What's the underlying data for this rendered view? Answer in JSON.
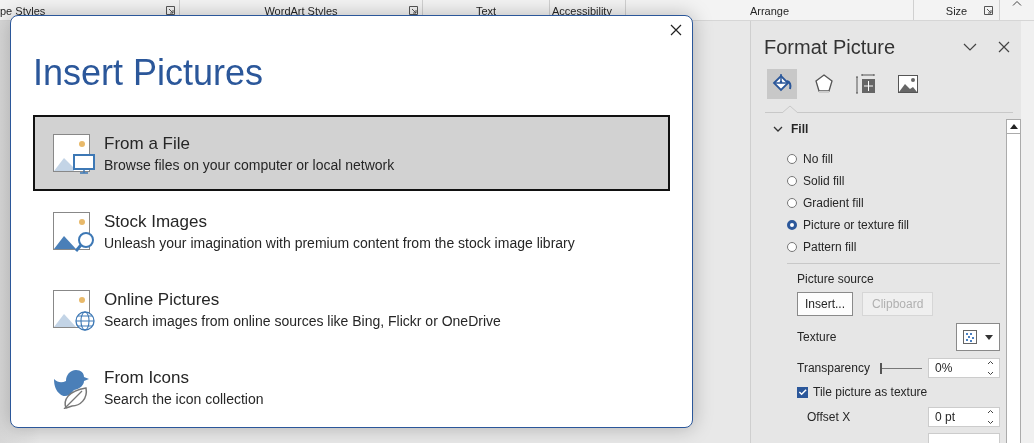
{
  "ribbon": {
    "groups": [
      {
        "label": "pe Styles",
        "launcher": true
      },
      {
        "label": "WordArt Styles",
        "launcher": true
      },
      {
        "label": "Text",
        "launcher": false
      },
      {
        "label": "Accessibility",
        "launcher": false
      },
      {
        "label": "Arrange",
        "launcher": false
      },
      {
        "label": "Size",
        "launcher": true
      }
    ]
  },
  "dialog": {
    "title": "Insert Pictures",
    "options": [
      {
        "kind": "file",
        "title": "From a File",
        "description": "Browse files on your computer or local network",
        "selected": true
      },
      {
        "kind": "stock",
        "title": "Stock Images",
        "description": "Unleash your imagination with premium content from the stock image library",
        "selected": false
      },
      {
        "kind": "online",
        "title": "Online Pictures",
        "description": "Search images from online sources like Bing, Flickr or OneDrive",
        "selected": false
      },
      {
        "kind": "icons",
        "title": "From Icons",
        "description": "Search the icon collection",
        "selected": false
      }
    ]
  },
  "pane": {
    "title": "Format Picture",
    "tabs": [
      {
        "kind": "fill",
        "selected": true
      },
      {
        "kind": "effects",
        "selected": false
      },
      {
        "kind": "size",
        "selected": false
      },
      {
        "kind": "picture",
        "selected": false
      }
    ],
    "section": {
      "label": "Fill",
      "expanded": true
    },
    "fill_options": [
      {
        "label": "No fill",
        "selected": false
      },
      {
        "label": "Solid fill",
        "selected": false
      },
      {
        "label": "Gradient fill",
        "selected": false
      },
      {
        "label": "Picture or texture fill",
        "selected": true
      },
      {
        "label": "Pattern fill",
        "selected": false
      }
    ],
    "picture_source": {
      "label": "Picture source",
      "buttons": [
        {
          "label": "Insert...",
          "disabled": false
        },
        {
          "label": "Clipboard",
          "disabled": true
        }
      ]
    },
    "texture": {
      "label": "Texture"
    },
    "transparency": {
      "label": "Transparency",
      "level": 0,
      "value": "0%"
    },
    "tile": {
      "label": "Tile picture as texture",
      "checked": true
    },
    "offset_x": {
      "label": "Offset X",
      "value": "0 pt"
    }
  }
}
